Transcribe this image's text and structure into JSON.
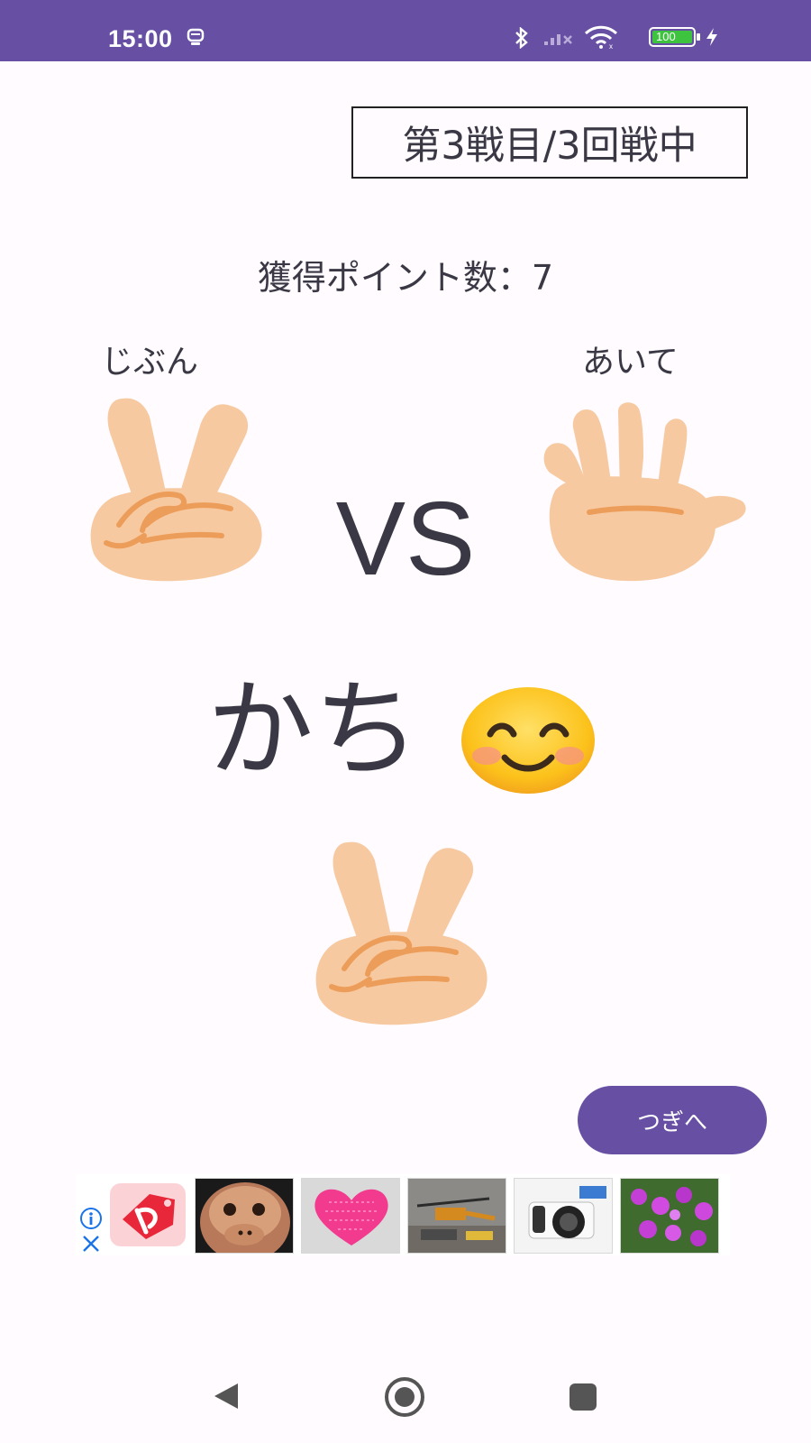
{
  "status_bar": {
    "time": "15:00",
    "battery": "100",
    "icons": [
      "notification-icon",
      "bluetooth-icon",
      "signal-icon",
      "wifi-icon",
      "battery-icon",
      "charging-icon"
    ]
  },
  "round": {
    "label": "第3戦目/3回戦中"
  },
  "points": {
    "label": "獲得ポイント数：7"
  },
  "players": {
    "self": "じぶん",
    "opponent": "あいて"
  },
  "hands": {
    "self": "peace-hand",
    "opponent": "open-hand",
    "result": "peace-hand"
  },
  "vs": "VS",
  "result": {
    "text": "かち",
    "emoji": "smiling-face"
  },
  "next_button": {
    "label": "つぎへ"
  },
  "ad": {
    "thumbnails": [
      "monkey-mask",
      "pink-heart",
      "toy-helicopter",
      "camera",
      "purple-flowers"
    ]
  },
  "colors": {
    "primary": "#6750a4",
    "background": "#fffbfe",
    "text": "#3a3845",
    "skin": "#f7c9a0",
    "skin_line": "#ec9d5a"
  }
}
